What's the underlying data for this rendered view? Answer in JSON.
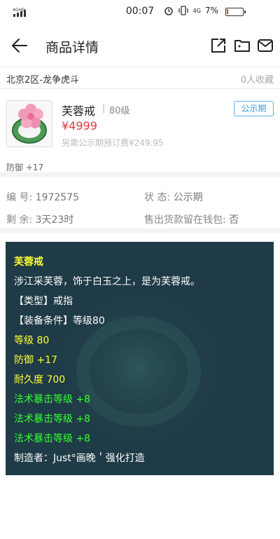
{
  "status_bar": {
    "time": "00:07",
    "network": "4G",
    "battery": "7%",
    "battery_level": 0.07
  },
  "header": {
    "title": "商品详情"
  },
  "server_row": {
    "server": "北京2区-龙争虎斗",
    "favorites": "0人收藏"
  },
  "item": {
    "name": "芙蓉戒",
    "level": "80级",
    "price": "¥4999",
    "fee": "另需公示期预订费¥249.95",
    "status_tag": "公示期",
    "defense": "防御 +17"
  },
  "info": {
    "id_label": "编   号:",
    "id_value": "1972575",
    "state_label": "状   态:",
    "state_value": "公示期",
    "remain_label": "剩   余:",
    "remain_value": "3天23时",
    "wallet_label": "售出货款留在钱包:",
    "wallet_value": "否"
  },
  "description": {
    "title": "芙蓉戒",
    "flavor": "涉江采芙蓉，饰于白玉之上，是为芙蓉戒。",
    "type": "【类型】戒指",
    "requirement": "【装备条件】等级80",
    "level": "等级 80",
    "defense": "防御 +17",
    "durability": "耐久度 700",
    "bonus_1": "法术暴击等级 +8",
    "bonus_2": "法术暴击等级 +8",
    "bonus_3": "法术暴击等级 +8",
    "maker": "制造者：Just°画晚＇强化打造"
  },
  "colors": {
    "price": "#e23a3a",
    "tag": "#3a9ad9",
    "desc_bg": "#1f3b47",
    "desc_yellow": "#ffff33",
    "desc_green": "#33ff33"
  },
  "icons": [
    "back-arrow-icon",
    "share-icon",
    "folder-icon",
    "mail-icon",
    "alarm-icon",
    "vibrate-icon",
    "signal-icon",
    "battery-icon"
  ]
}
